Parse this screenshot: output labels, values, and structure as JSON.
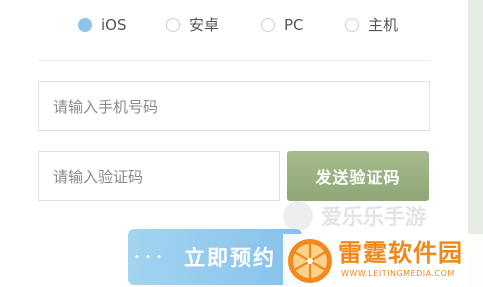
{
  "platforms": [
    {
      "label": "iOS",
      "selected": true
    },
    {
      "label": "安卓",
      "selected": false
    },
    {
      "label": "PC",
      "selected": false
    },
    {
      "label": "主机",
      "selected": false
    }
  ],
  "form": {
    "phone_placeholder": "请输入手机号码",
    "code_placeholder": "请输入验证码",
    "send_code_label": "发送验证码",
    "reserve_label": "立即预约",
    "reserve_dots": "• • •"
  },
  "watermarks": {
    "site_one": "爱乐乐手游",
    "site_two_title": "雷霆软件园",
    "site_two_url": "WWW.LEITINGMEDIA.COM"
  },
  "colors": {
    "radio_selected": "#8ec3ec",
    "send_button": "#9bb282",
    "reserve_button": "#93c9ef",
    "watermark_orange": "#f0891c"
  }
}
